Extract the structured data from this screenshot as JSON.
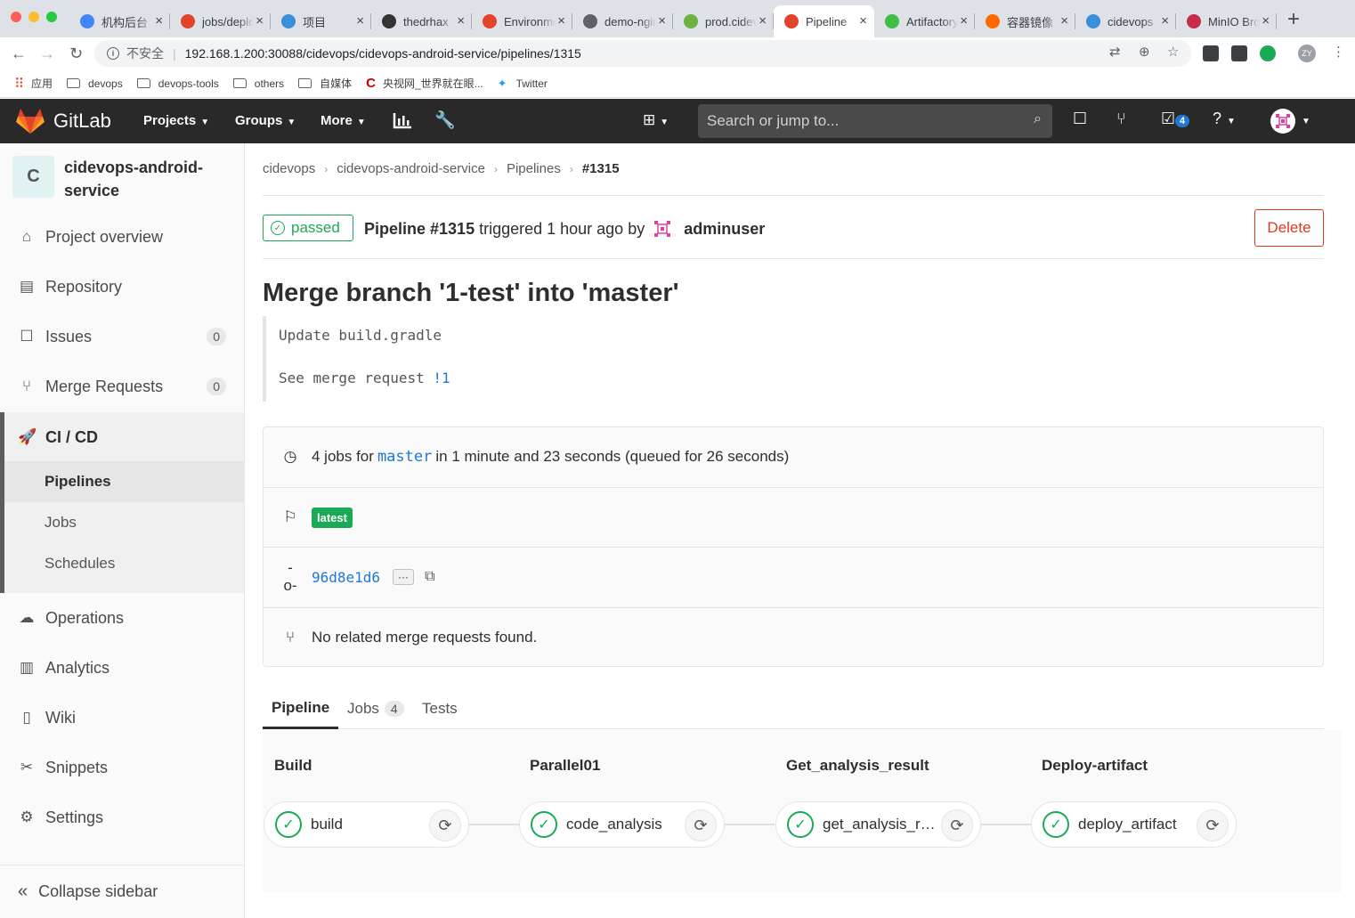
{
  "browser": {
    "tabs": [
      {
        "title": "机构后台",
        "favicon": "shield-icon",
        "color": "#4285f4"
      },
      {
        "title": "jobs/deploy",
        "favicon": "gitlab-icon",
        "color": "#e24329"
      },
      {
        "title": "项目",
        "favicon": "wave-icon",
        "color": "#3b8fd9"
      },
      {
        "title": "thedrhax",
        "favicon": "github-icon",
        "color": "#333333"
      },
      {
        "title": "Environments",
        "favicon": "gitlab-icon",
        "color": "#e24329"
      },
      {
        "title": "demo-nginx",
        "favicon": "globe-icon",
        "color": "#5f6368"
      },
      {
        "title": "prod.cidevops",
        "favicon": "leaf-icon",
        "color": "#6db33f"
      },
      {
        "title": "Pipeline",
        "favicon": "gitlab-pipeline-icon",
        "color": "#e24329",
        "active": true
      },
      {
        "title": "Artifactory",
        "favicon": "artifactory-icon",
        "color": "#40be46"
      },
      {
        "title": "容器镜像",
        "favicon": "aliyun-icon",
        "color": "#ff6a00"
      },
      {
        "title": "cidevops",
        "favicon": "wave-icon",
        "color": "#3b8fd9"
      },
      {
        "title": "MinIO Browser",
        "favicon": "minio-icon",
        "color": "#c72c48"
      }
    ],
    "insecure_label": "不安全",
    "url": "192.168.1.200:30088/cidevops/cidevops-android-service/pipelines/1315",
    "profile_initials": "ZY",
    "bookmarks": [
      {
        "label": "应用",
        "icon": "apps-grid-icon"
      },
      {
        "label": "devops",
        "icon": "folder-icon"
      },
      {
        "label": "devops-tools",
        "icon": "folder-icon"
      },
      {
        "label": "others",
        "icon": "folder-icon"
      },
      {
        "label": "自媒体",
        "icon": "folder-icon"
      },
      {
        "label": "央视网_世界就在眼...",
        "icon": "cctv-icon"
      },
      {
        "label": "Twitter",
        "icon": "twitter-icon"
      }
    ]
  },
  "gitlab_nav": {
    "brand": "GitLab",
    "projects": "Projects",
    "groups": "Groups",
    "more": "More",
    "search_placeholder": "Search or jump to...",
    "todo_count": "4"
  },
  "sidebar": {
    "project_letter": "C",
    "project_name": "cidevops-android-service",
    "items": [
      {
        "label": "Project overview",
        "icon": "home-icon"
      },
      {
        "label": "Repository",
        "icon": "book-icon"
      },
      {
        "label": "Issues",
        "icon": "issues-icon",
        "count": "0"
      },
      {
        "label": "Merge Requests",
        "icon": "merge-request-icon",
        "count": "0"
      },
      {
        "label": "CI / CD",
        "icon": "rocket-icon"
      },
      {
        "label": "Operations",
        "icon": "cloud-gear-icon"
      },
      {
        "label": "Analytics",
        "icon": "chart-icon"
      },
      {
        "label": "Wiki",
        "icon": "wiki-icon"
      },
      {
        "label": "Snippets",
        "icon": "scissors-icon"
      },
      {
        "label": "Settings",
        "icon": "settings-icon"
      }
    ],
    "cicd_sub": [
      "Pipelines",
      "Jobs",
      "Schedules"
    ],
    "collapse": "Collapse sidebar"
  },
  "breadcrumb": [
    "cidevops",
    "cidevops-android-service",
    "Pipelines",
    "#1315"
  ],
  "pipeline": {
    "status": "passed",
    "id_text": "Pipeline #1315",
    "triggered_text": "triggered 1 hour ago by",
    "user": "adminuser",
    "delete_label": "Delete",
    "commit_title": "Merge branch '1-test' into 'master'",
    "commit_desc_line1": "Update build.gradle",
    "commit_desc_line2": "See merge request",
    "mr_ref": "!1",
    "jobs_prefix": "4 jobs for",
    "branch": "master",
    "jobs_suffix": "in 1 minute and 23 seconds (queued for 26 seconds)",
    "latest_badge": "latest",
    "sha": "96d8e1d6",
    "ellipsis": "···",
    "no_mr": "No related merge requests found."
  },
  "tabs": {
    "pipeline": "Pipeline",
    "jobs": "Jobs",
    "jobs_count": "4",
    "tests": "Tests"
  },
  "stages": [
    {
      "name": "Build",
      "job": "build"
    },
    {
      "name": "Parallel01",
      "job": "code_analysis"
    },
    {
      "name": "Get_analysis_result",
      "job": "get_analysis_re..."
    },
    {
      "name": "Deploy-artifact",
      "job": "deploy_artifact"
    }
  ],
  "colors": {
    "success": "#1aaa55",
    "danger": "#db3b21",
    "link": "#1f78d1",
    "nav_bg": "#292929"
  }
}
